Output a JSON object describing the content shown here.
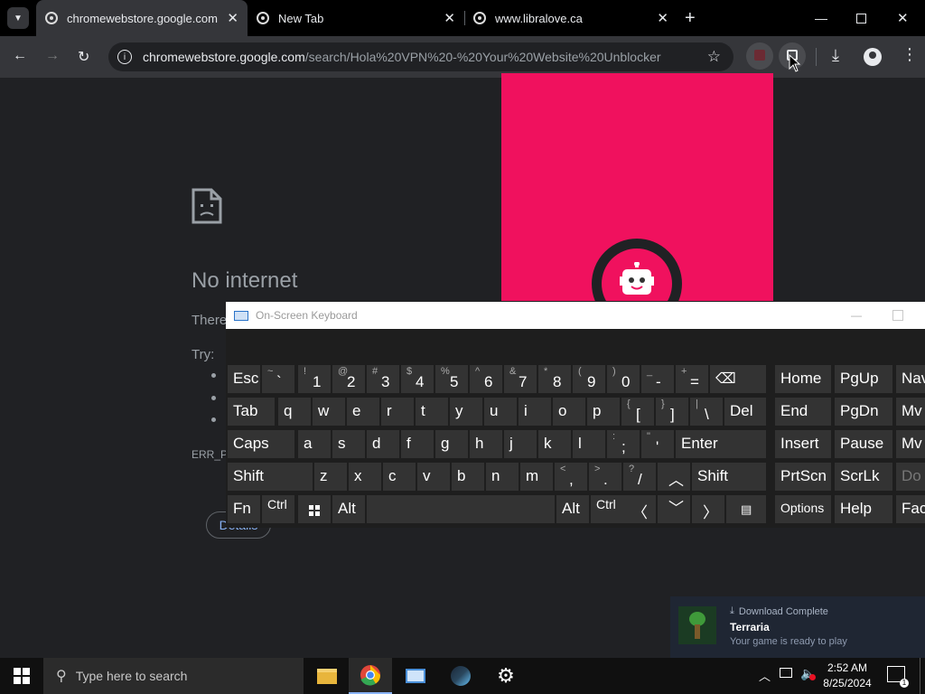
{
  "browser": {
    "tabs": [
      {
        "title": "chromewebstore.google.com"
      },
      {
        "title": "New Tab"
      },
      {
        "title": "www.libralove.ca"
      }
    ],
    "address": {
      "domain": "chromewebstore.google.com",
      "path": "/search/Hola%20VPN%20-%20Your%20Website%20Unblocker"
    }
  },
  "error_page": {
    "heading": "No internet",
    "body_start": "There",
    "try_label": "Try:",
    "error_code": "ERR_PR",
    "details_button": "Details"
  },
  "osk": {
    "title": "On-Screen Keyboard",
    "keys": {
      "esc": "Esc",
      "tab": "Tab",
      "caps": "Caps",
      "shift": "Shift",
      "fn": "Fn",
      "ctrl": "Ctrl",
      "alt": "Alt",
      "enter": "Enter",
      "del": "Del",
      "home": "Home",
      "pgup": "PgUp",
      "nav": "Nav",
      "end": "End",
      "pgdn": "PgDn",
      "mv": "Mv",
      "insert": "Insert",
      "pause": "Pause",
      "prtscn": "PrtScn",
      "scrlk": "ScrLk",
      "dock": "Do",
      "options": "Options",
      "help": "Help",
      "fade": "Fac",
      "q": "q",
      "w": "w",
      "e": "e",
      "r": "r",
      "t": "t",
      "y": "y",
      "u": "u",
      "i": "i",
      "o": "o",
      "p": "p",
      "a": "a",
      "s": "s",
      "d": "d",
      "f": "f",
      "g": "g",
      "h": "h",
      "j": "j",
      "k": "k",
      "l": "l",
      "z": "z",
      "x": "x",
      "c": "c",
      "v": "v",
      "b": "b",
      "n": "n",
      "m": "m",
      "1": "1",
      "1s": "!",
      "2": "2",
      "2s": "@",
      "3": "3",
      "3s": "#",
      "4": "4",
      "4s": "$",
      "5": "5",
      "5s": "%",
      "6": "6",
      "6s": "^",
      "7": "7",
      "7s": "&",
      "8": "8",
      "8s": "*",
      "9": "9",
      "9s": "(",
      "0": "0",
      "0s": ")",
      "minus": "-",
      "minuss": "_",
      "eq": "=",
      "eqs": "+",
      "tilde": "`",
      "tildes": "~",
      "lbr": "[",
      "lbrs": "{",
      "rbr": "]",
      "rbrs": "}",
      "bsl": "\\",
      "bsls": "|",
      "semi": ";",
      "semis": ":",
      "quote": "'",
      "quotes": "\"",
      "comma": ",",
      "commas": "<",
      "period": ".",
      "periods": ">",
      "slash": "/",
      "slashs": "?"
    }
  },
  "notification": {
    "status": "Download Complete",
    "app": "Terraria",
    "message": "Your game is ready to play"
  },
  "taskbar": {
    "search_placeholder": "Type here to search",
    "time": "2:52 AM",
    "date": "8/25/2024"
  },
  "colors": {
    "accent_pink": "#f0115e",
    "page_bg": "#202124"
  }
}
